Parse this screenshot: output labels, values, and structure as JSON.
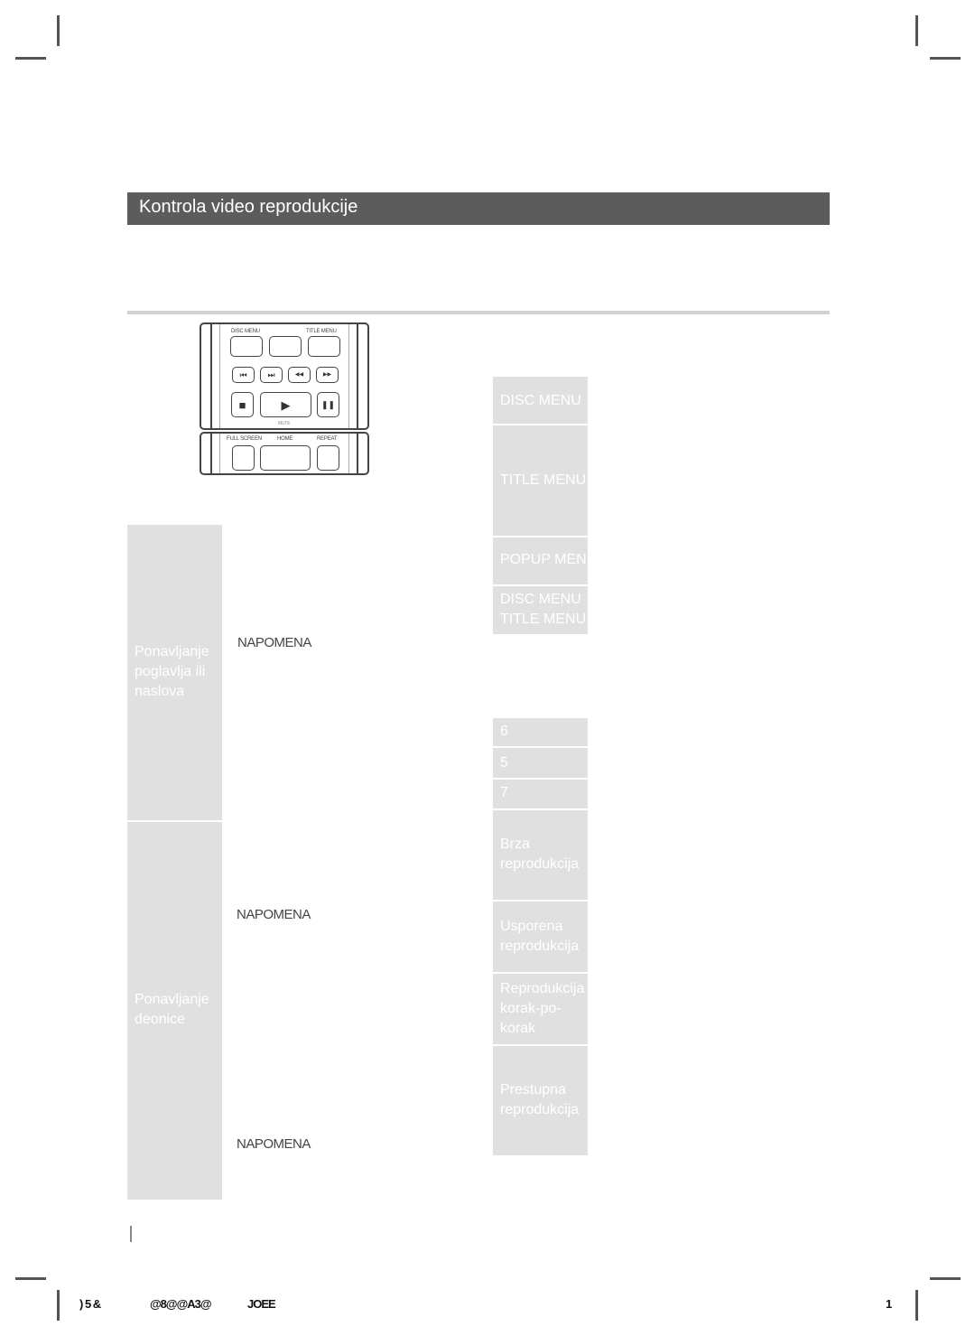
{
  "page": {
    "section_title": "Kontrola video reprodukcije"
  },
  "remote": {
    "disc_menu": "DISC MENU",
    "title_menu": "TITLE MENU",
    "mute": "MUTE",
    "full_screen": "FULL SCREEN",
    "home": "HOME",
    "repeat": "REPEAT",
    "icons": {
      "skip_back": "⏮",
      "skip_forward": "⏭",
      "rewind": "◀◀",
      "fast_forward": "▶▶",
      "stop": "■",
      "play": "▶",
      "pause": "❚❚"
    }
  },
  "left_table": {
    "rows": [
      {
        "label": "Ponavljanje poglavlja ili naslova",
        "notes": [
          "NAPOMENA"
        ]
      },
      {
        "label": "Ponavljanje deonice",
        "notes": [
          "NAPOMENA",
          "NAPOMENA"
        ]
      }
    ]
  },
  "right_table_menus": {
    "rows": [
      {
        "label": "DISC MENU"
      },
      {
        "label": "TITLE MENU"
      },
      {
        "label": "POPUP MENU"
      },
      {
        "label": "DISC MENU TITLE MENU"
      }
    ]
  },
  "right_table_playback": {
    "rows": [
      {
        "label": "6"
      },
      {
        "label": "5"
      },
      {
        "label": "7"
      },
      {
        "label": "Brza reprodukcija"
      },
      {
        "label": "Usporena reprodukcija"
      },
      {
        "label": "Reprodukcija korak-po-korak"
      },
      {
        "label": "Prestupna reprodukcija"
      }
    ]
  },
  "footer": {
    "left_code": ") 5   &",
    "middle_code": "@8@@A3@",
    "right_code": "JOEE",
    "page_number": "1"
  }
}
